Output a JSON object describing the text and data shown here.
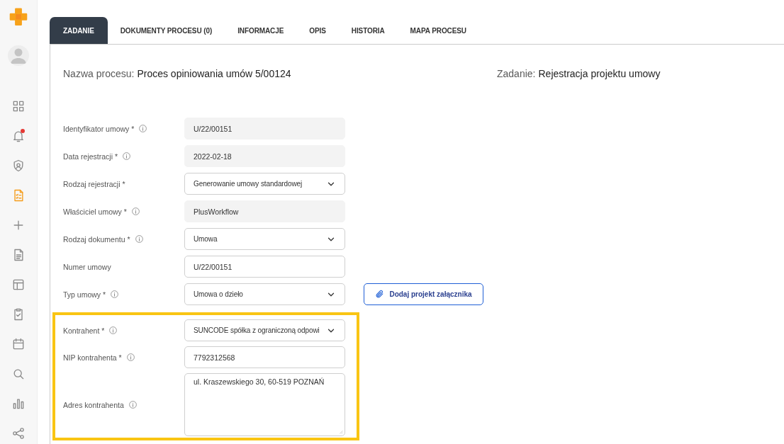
{
  "sidebar": {
    "items": [
      {
        "kind": "grid",
        "selected": false,
        "badge": false
      },
      {
        "kind": "bell",
        "selected": false,
        "badge": true
      },
      {
        "kind": "shield",
        "selected": false,
        "badge": false
      },
      {
        "kind": "tasklist",
        "selected": true,
        "badge": false
      },
      {
        "kind": "plus",
        "selected": false,
        "badge": false
      },
      {
        "kind": "document",
        "selected": false,
        "badge": false
      },
      {
        "kind": "layout",
        "selected": false,
        "badge": false
      },
      {
        "kind": "clipboard",
        "selected": false,
        "badge": false
      },
      {
        "kind": "calendar",
        "selected": false,
        "badge": false
      },
      {
        "kind": "search",
        "selected": false,
        "badge": false
      },
      {
        "kind": "chart",
        "selected": false,
        "badge": false
      },
      {
        "kind": "share",
        "selected": false,
        "badge": false
      }
    ]
  },
  "tabs": [
    {
      "label": "ZADANIE",
      "selected": true
    },
    {
      "label": "DOKUMENTY PROCESU (0)",
      "selected": false
    },
    {
      "label": "INFORMACJE",
      "selected": false
    },
    {
      "label": "OPIS",
      "selected": false
    },
    {
      "label": "HISTORIA",
      "selected": false
    },
    {
      "label": "MAPA PROCESU",
      "selected": false
    }
  ],
  "header": [
    {
      "label": "Nazwa procesu:",
      "value": "Proces opiniowania umów 5/00124"
    },
    {
      "label": "Zadanie:",
      "value": "Rejestracja projektu umowy"
    }
  ],
  "sections": [
    {
      "highlighted": false,
      "rows": [
        {
          "label": "Identyfikator umowy *",
          "info": true,
          "kind": "readonly",
          "value": "U/22/00151"
        },
        {
          "label": "Data rejestracji *",
          "info": true,
          "kind": "readonly",
          "value": "2022-02-18"
        },
        {
          "label": "Rodzaj rejestracji *",
          "info": false,
          "kind": "select",
          "value": "Generowanie umowy standardowej"
        },
        {
          "label": "Właściciel umowy *",
          "info": true,
          "kind": "readonly",
          "value": "PlusWorkflow"
        },
        {
          "label": "Rodzaj dokumentu *",
          "info": true,
          "kind": "select",
          "value": "Umowa"
        },
        {
          "label": "Numer umowy",
          "info": false,
          "kind": "text",
          "value": "U/22/00151"
        },
        {
          "label": "Typ umowy *",
          "info": true,
          "kind": "select",
          "value": "Umowa o dzieło",
          "button": "Dodaj projekt załącznika"
        }
      ]
    },
    {
      "highlighted": true,
      "rows": [
        {
          "label": "Kontrahent *",
          "info": true,
          "kind": "select",
          "value": "SUNCODE spółka z ograniczoną odpowi"
        },
        {
          "label": "NIP kontrahenta *",
          "info": true,
          "kind": "text",
          "value": "7792312568"
        },
        {
          "label": "Adres kontrahenta",
          "info": true,
          "kind": "textarea",
          "value": "ul. Kraszewskiego 30, 60-519 POZNAŃ"
        }
      ]
    }
  ]
}
